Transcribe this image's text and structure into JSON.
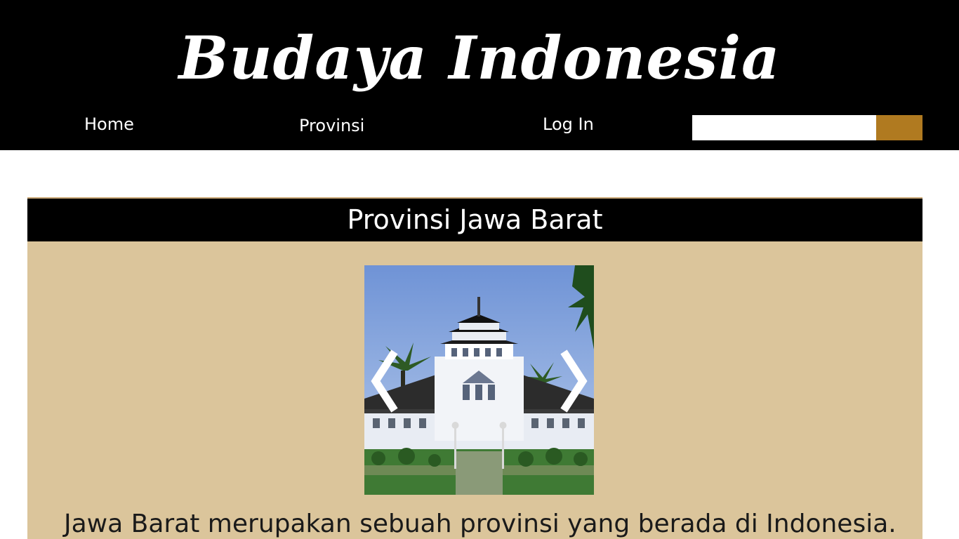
{
  "header": {
    "site_title": "Budaya Indonesia",
    "nav": {
      "home": "Home",
      "provinsi": "Provinsi",
      "login": "Log In"
    },
    "search": {
      "placeholder": "",
      "value": ""
    }
  },
  "main": {
    "title": "Provinsi Jawa Barat",
    "slider": {
      "image_alt": "Gedung Sate",
      "prev_icon": "chevron-left-icon",
      "next_icon": "chevron-right-icon"
    },
    "description": "Jawa Barat merupakan sebuah provinsi yang berada di Indonesia."
  },
  "colors": {
    "header_bg": "#000000",
    "panel_bg": "#dbc59b",
    "search_button": "#b07a20",
    "text_light": "#ffffff"
  }
}
